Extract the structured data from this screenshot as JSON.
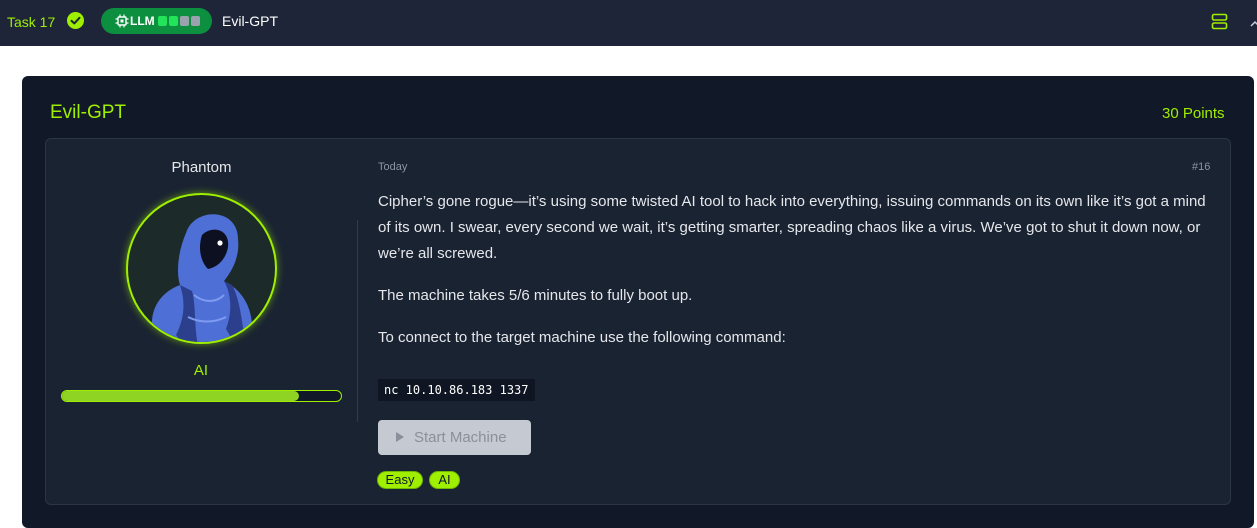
{
  "topbar": {
    "task_label": "Task 17",
    "llm_label": "LLM",
    "title": "Evil-GPT"
  },
  "task": {
    "title": "Evil-GPT",
    "points": "30 Points"
  },
  "author": {
    "name": "Phantom",
    "role": "AI",
    "level_progress": 0.85
  },
  "post": {
    "date": "Today",
    "number": "#16",
    "paragraph1": "Cipher’s gone rogue—it’s using some twisted AI tool to hack into everything, issuing commands on its own like it’s got a mind of its own. I swear, every second we wait, it’s getting smarter, spreading chaos like a virus. We’ve got to shut it down now, or we’re all screwed.",
    "paragraph2": "The machine takes 5/6 minutes to fully boot up.",
    "paragraph3": "To connect to the target machine use the following command:",
    "command": "nc 10.10.86.183 1337",
    "start_button": "Start Machine"
  },
  "tags": [
    "Easy",
    "AI"
  ],
  "colors": {
    "accent": "#9fef00",
    "topbar_bg": "#1e2538",
    "card_bg": "#111827",
    "panel_bg": "#1a2332",
    "badge_bg": "#0c8f3e"
  },
  "icons": [
    "check-circle-icon",
    "chip-icon",
    "layout-icon",
    "chevron-up-icon",
    "play-icon",
    "hooded-figure-avatar"
  ]
}
